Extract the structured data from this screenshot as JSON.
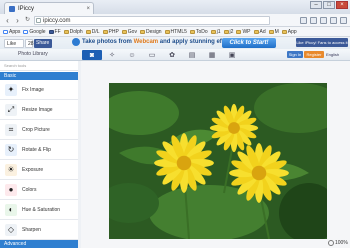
{
  "browser": {
    "tab_title": "IPiccy",
    "url": "ipiccy.com",
    "bookmarks": [
      "Apps",
      "Google",
      "FF",
      "Dolph",
      "D/L",
      "PHP",
      "Gov",
      "Design",
      "HTML5",
      "ToDo",
      "j1",
      "j2",
      "WP",
      "Ad",
      "M",
      "App"
    ]
  },
  "header": {
    "fb_like_label": "Like",
    "fb_like_count": "28",
    "fb_share_label": "Share",
    "promo_prefix": "Take photos from ",
    "promo_highlight": "Webcam",
    "promo_suffix": " and apply stunning effects!",
    "start_button": "Click to Start!",
    "like_app_text": "Like IPiccy! Fans to access it"
  },
  "nav": {
    "library_label": "Photo Library",
    "icons": [
      "camera-icon",
      "wand-icon",
      "person-icon",
      "frame-icon",
      "sticker-icon",
      "text-icon",
      "collage-icon",
      "save-icon"
    ],
    "sign_in": "Sign In",
    "register": "Register",
    "language": "English"
  },
  "sidebar": {
    "search_placeholder": "Search tools",
    "section_basic": "Basic",
    "section_advanced": "Advanced",
    "tools": [
      {
        "label": "Fix Image",
        "icon": "fix-image-icon",
        "color": "#e7f0fb",
        "glyph": "✦"
      },
      {
        "label": "Resize Image",
        "icon": "resize-icon",
        "color": "#eef2f6",
        "glyph": "⤢"
      },
      {
        "label": "Crop Picture",
        "icon": "crop-icon",
        "color": "#eef2f6",
        "glyph": "⌗"
      },
      {
        "label": "Rotate & Flip",
        "icon": "rotate-icon",
        "color": "#e7f0fb",
        "glyph": "↻"
      },
      {
        "label": "Exposure",
        "icon": "exposure-icon",
        "color": "#fbf1e0",
        "glyph": "☀"
      },
      {
        "label": "Colors",
        "icon": "colors-icon",
        "color": "#fde9ec",
        "glyph": "●"
      },
      {
        "label": "Hue & Saturation",
        "icon": "hue-icon",
        "color": "#e9f6ea",
        "glyph": "◐"
      },
      {
        "label": "Sharpen",
        "icon": "sharpen-icon",
        "color": "#eef2f6",
        "glyph": "◇"
      }
    ]
  },
  "canvas": {
    "zoom": "100%"
  }
}
